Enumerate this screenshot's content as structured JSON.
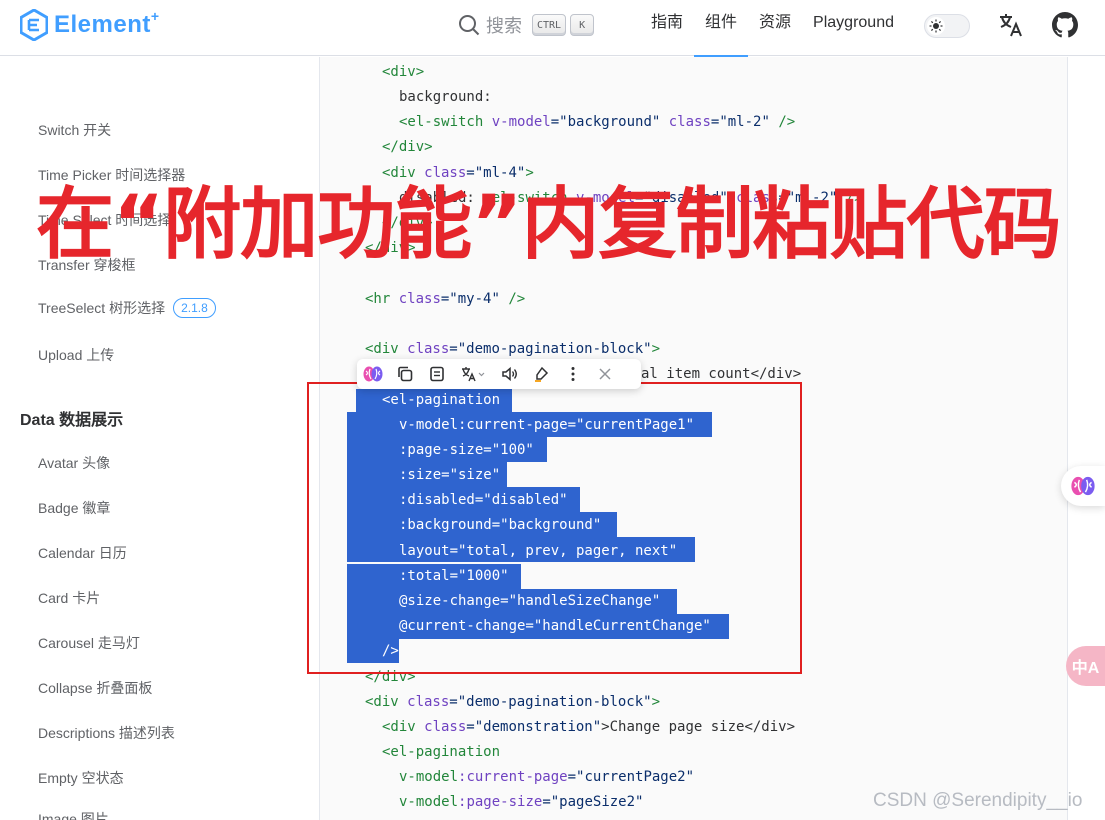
{
  "header": {
    "logo_text": "Element",
    "logo_plus": "+",
    "search_label": "搜索",
    "kbd_ctrl": "CTRL",
    "kbd_k": "K",
    "nav": [
      "指南",
      "组件",
      "资源",
      "Playground"
    ],
    "active_nav": "组件"
  },
  "sidebar": {
    "items_top": [
      {
        "label": "Switch 开关"
      },
      {
        "label": "Time Picker 时间选择器"
      },
      {
        "label": "Time Select 时间选择"
      },
      {
        "label": "Transfer 穿梭框"
      },
      {
        "label": "TreeSelect 树形选择",
        "badge": "2.1.8"
      },
      {
        "label": "Upload 上传"
      }
    ],
    "group_title": "Data 数据展示",
    "items_data": [
      {
        "label": "Avatar 头像"
      },
      {
        "label": "Badge 徽章"
      },
      {
        "label": "Calendar 日历"
      },
      {
        "label": "Card 卡片"
      },
      {
        "label": "Carousel 走马灯"
      },
      {
        "label": "Collapse 折叠面板"
      },
      {
        "label": "Descriptions 描述列表"
      },
      {
        "label": "Empty 空状态"
      },
      {
        "label": "Image 图片"
      }
    ]
  },
  "code": {
    "l01": "<div>",
    "l02": "background:",
    "l03a": "<el-switch",
    "l03b": " v-model",
    "l03c": "=\"background\"",
    "l03d": " class",
    "l03e": "=\"ml-2\"",
    "l03f": " />",
    "l04": "</div>",
    "l05a": "<div",
    "l05b": " class",
    "l05c": "=\"ml-4\"",
    "l05d": ">",
    "l06a": "disabled: ",
    "l06b": "<el-switch",
    "l06c": " v-model",
    "l06d": "=\"disabled\"",
    "l06e": " class",
    "l06f": "=\"ml-2\"",
    "l06g": " />",
    "l07": "</div>",
    "l08": "</div>",
    "l09a": "<hr",
    "l09b": " class",
    "l09c": "=\"my-4\"",
    "l09d": " />",
    "l10a": "<div",
    "l10b": " class",
    "l10c": "=\"demo-pagination-block\"",
    "l10d": ">",
    "l11": "al item count</div>",
    "s01": "<el-pagination",
    "s02": "v-model:current-page=\"currentPage1\"",
    "s03": ":page-size=\"100\"",
    "s04": ":size=\"size\"",
    "s05": ":disabled=\"disabled\"",
    "s06": ":background=\"background\"",
    "s07": "layout=\"total, prev, pager, next\"",
    "s08": ":total=\"1000\"",
    "s09": "@size-change=\"handleSizeChange\"",
    "s10": "@current-change=\"handleCurrentChange\"",
    "s11": "/>",
    "l12": "</div>",
    "l13a": "<div",
    "l13b": " class",
    "l13c": "=\"demo-pagination-block\"",
    "l13d": ">",
    "l14a": "<div",
    "l14b": " class",
    "l14c": "=\"demonstration\"",
    "l14d": ">Change page size</div>",
    "l15": "<el-pagination",
    "l16a": "v-model",
    "l16b": ":current-page",
    "l16c": "=\"currentPage2\"",
    "l17a": "v-model",
    "l17b": ":page-size",
    "l17c": "=\"pageSize2\""
  },
  "overlay_title": "在“附加功能”内复制粘贴代码",
  "float_translate_label": "中A",
  "watermark": "CSDN @Serendipity__io",
  "colors": {
    "brand": "#409eff",
    "selection": "#2f64cf",
    "annotation_red": "#e6262c"
  }
}
